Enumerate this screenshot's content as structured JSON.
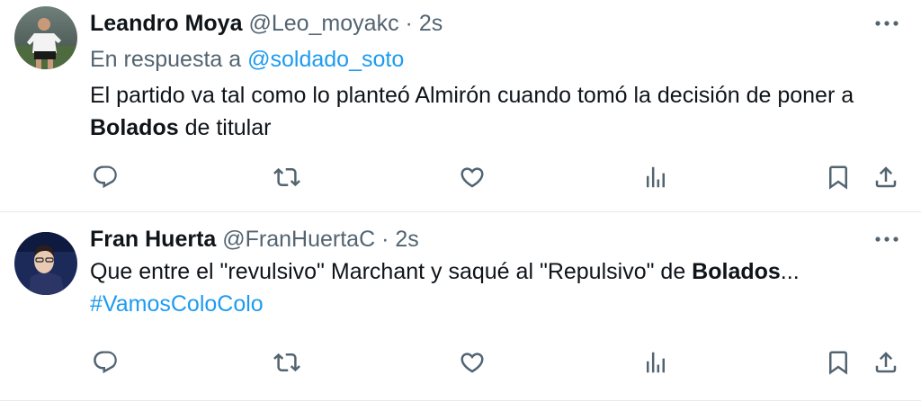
{
  "tweets": [
    {
      "display_name": "Leandro Moya",
      "handle": "@Leo_moyakc",
      "separator": "·",
      "time": "2s",
      "reply_prefix": "En respuesta a",
      "reply_to": "@soldado_soto",
      "text_part1": "El partido va tal como lo planteó Almirón cuando tomó la decisión de poner a ",
      "text_bold": "Bolados",
      "text_part2": " de titular",
      "avatar": "avatar-photo-soccer-player",
      "icons": {
        "more": "more-horizontal-icon",
        "reply": "reply-icon",
        "retweet": "retweet-icon",
        "like": "heart-icon",
        "views": "views-icon",
        "bookmark": "bookmark-icon",
        "share": "share-icon"
      }
    },
    {
      "display_name": "Fran Huerta",
      "handle": "@FranHuertaC",
      "separator": "·",
      "time": "2s",
      "text_part1": "Que entre el \"revulsivo\" Marchant y saqué al \"Repulsivo\" de ",
      "text_bold": "Bolados",
      "text_part2": "...",
      "hashtag": "#VamosColoColo",
      "avatar": "avatar-photo-man",
      "icons": {
        "more": "more-horizontal-icon",
        "reply": "reply-icon",
        "retweet": "retweet-icon",
        "like": "heart-icon",
        "views": "views-icon",
        "bookmark": "bookmark-icon",
        "share": "share-icon"
      }
    }
  ],
  "colors": {
    "text_primary": "#0f1419",
    "text_secondary": "#536471",
    "link": "#1d9bf0",
    "divider": "#e6e9eb"
  }
}
